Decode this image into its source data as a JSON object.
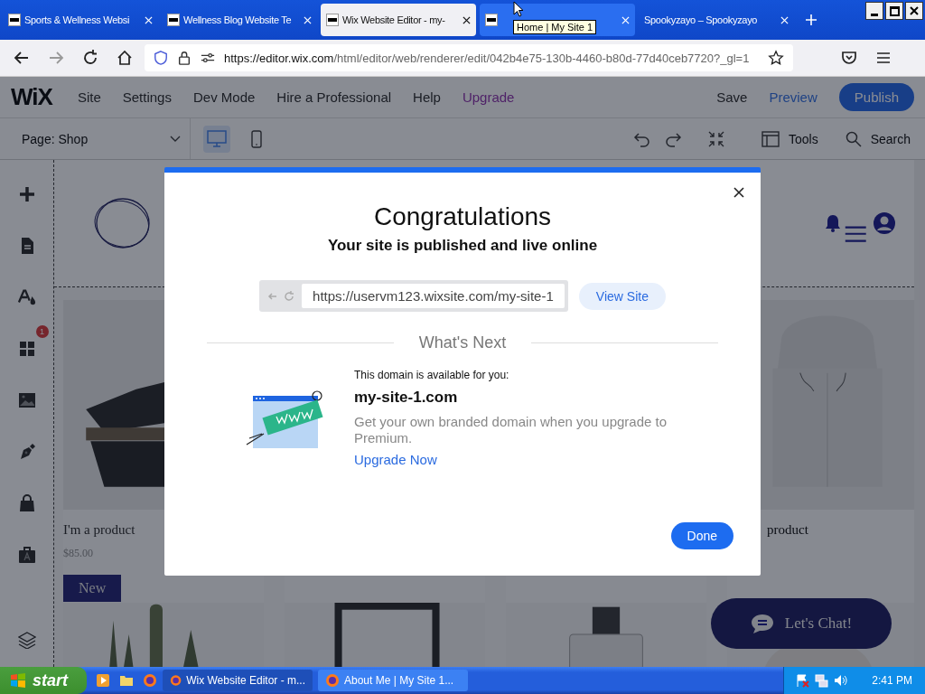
{
  "browser": {
    "tabs": [
      {
        "label": "Sports & Wellness Websi",
        "selected": false
      },
      {
        "label": "Wellness Blog Website Te",
        "selected": false
      },
      {
        "label": "Wix Website Editor - my-",
        "selected": true
      },
      {
        "selected": false
      },
      {
        "label": "Spookyzayo – Spookyzayo",
        "selected": false
      }
    ],
    "tooltip": "Home | My Site 1",
    "url_host": "https://editor.wix.com",
    "url_path": "/html/editor/web/renderer/edit/042b4e75-130b-4460-b80d-77d40ceb7720?_gl=1"
  },
  "editor": {
    "logo": "WiX",
    "menu": [
      {
        "label": "Site",
        "kind": "item"
      },
      {
        "label": "Settings",
        "kind": "item"
      },
      {
        "label": "Dev Mode",
        "kind": "item"
      },
      {
        "label": "Hire a Professional",
        "kind": "item"
      },
      {
        "label": "Help",
        "kind": "item"
      },
      {
        "label": "Upgrade",
        "kind": "upgrade"
      }
    ],
    "save": "Save",
    "preview": "Preview",
    "publish": "Publish",
    "page": "Page: Shop",
    "tools": "Tools",
    "search": "Search",
    "apps_badge": "1",
    "products": [
      {
        "name": "I'm a product",
        "price": "$85.00",
        "badge": "New"
      },
      {
        "name": "product"
      }
    ],
    "chat": "Let's Chat!"
  },
  "modal": {
    "title": "Congratulations",
    "subtitle": "Your site is published and live online",
    "site_url": "https://uservm123.wixsite.com/my-site-1",
    "view_site": "View Site",
    "section": "What's Next",
    "domain_label": "This domain is available for you:",
    "domain": "my-site-1.com",
    "description": "Get your own branded domain when you upgrade to Premium.",
    "upgrade": "Upgrade Now",
    "done": "Done"
  },
  "taskbar": {
    "start": "start",
    "tasks": [
      {
        "label": "Wix Website Editor - m...",
        "selected": true
      },
      {
        "label": "About Me | My Site 1...",
        "selected": false
      }
    ],
    "time": "2:41 PM"
  }
}
